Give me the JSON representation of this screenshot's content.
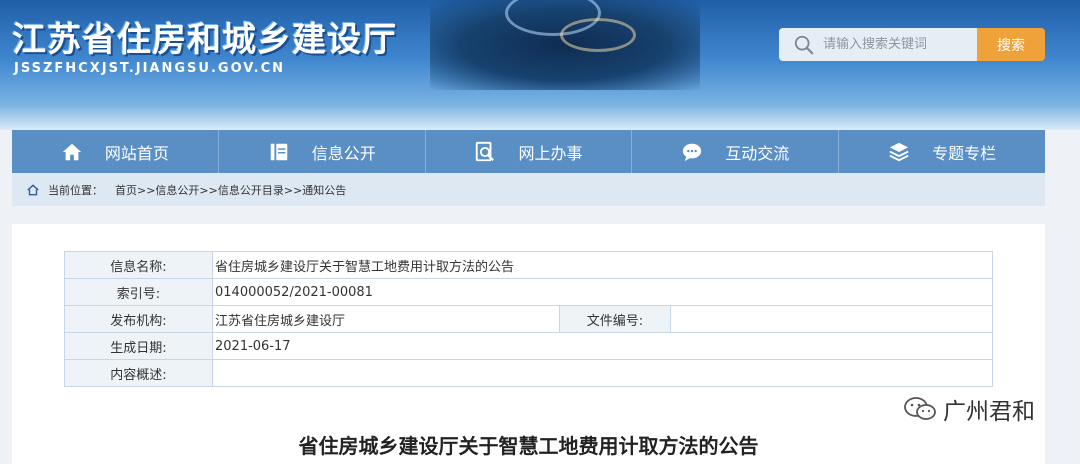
{
  "header": {
    "site_title": "江苏省住房和城乡建设厅",
    "site_domain": "JSSZFHCXJST.JIANGSU.GOV.CN",
    "search": {
      "placeholder": "请输入搜索关键词",
      "button_label": "搜索"
    }
  },
  "nav": {
    "items": [
      {
        "label": "网站首页",
        "icon": "home-icon"
      },
      {
        "label": "信息公开",
        "icon": "document-icon"
      },
      {
        "label": "网上办事",
        "icon": "search-doc-icon"
      },
      {
        "label": "互动交流",
        "icon": "chat-icon"
      },
      {
        "label": "专题专栏",
        "icon": "layers-icon"
      }
    ]
  },
  "breadcrumb": {
    "label": "当前位置：",
    "path": "首页>>信息公开>>信息公开目录>>通知公告"
  },
  "info_table": {
    "name_label": "信息名称:",
    "name_value": "省住房城乡建设厅关于智慧工地费用计取方法的公告",
    "index_label": "索引号:",
    "index_value": "014000052/2021-00081",
    "org_label": "发布机构:",
    "org_value": "江苏省住房城乡建设厅",
    "docno_label": "文件编号:",
    "docno_value": "",
    "date_label": "生成日期:",
    "date_value": "2021-06-17",
    "summary_label": "内容概述:",
    "summary_value": ""
  },
  "article": {
    "title": "省住房城乡建设厅关于智慧工地费用计取方法的公告"
  },
  "watermark": {
    "text": "广州君和",
    "icon": "wechat-icon"
  },
  "colors": {
    "nav": "#5a8fc6",
    "search_button": "#f0a23a",
    "breadcrumb_bg": "#dde8f3"
  }
}
